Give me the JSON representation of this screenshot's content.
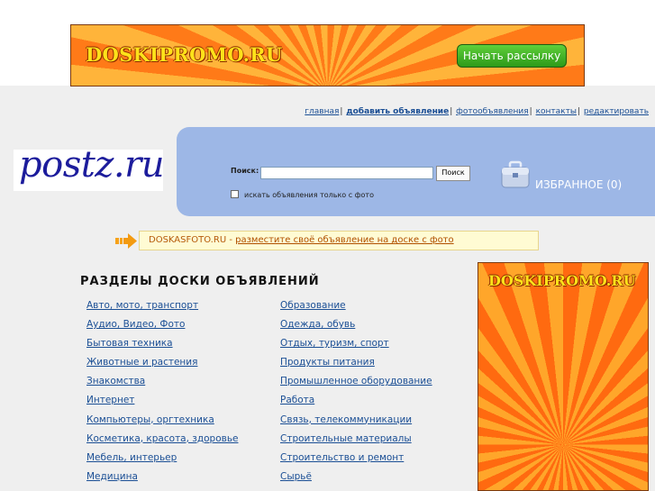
{
  "top_banner": {
    "brand": "DOSKIPROMO.RU",
    "button_label": "Начать рассылку"
  },
  "topnav": {
    "links": [
      {
        "label": "главная"
      },
      {
        "label": "добавить объявление"
      },
      {
        "label": "фотообъявления"
      },
      {
        "label": "контакты"
      },
      {
        "label": "редактировать"
      }
    ],
    "separator": "|"
  },
  "logo": {
    "text": "postz.ru"
  },
  "search": {
    "label": "Поиск:",
    "value": "",
    "button_label": "Поиск",
    "photo_only_label": "искать объявления только с фото",
    "photo_only_checked": false
  },
  "favorites": {
    "label": "ИЗБРАННОЕ (0)",
    "icon": "briefcase-icon"
  },
  "promo": {
    "site": "DOSKASFOTO.RU",
    "separator": " - ",
    "link_text": "разместите своё объявление на доске с фото",
    "icon": "arrow-right-icon"
  },
  "sections": {
    "title": "РАЗДЕЛЫ ДОСКИ ОБЪЯВЛЕНИЙ",
    "left": [
      "Авто, мото, транспорт",
      "Аудио, Видео, Фото",
      "Бытовая техника",
      "Животные и растения",
      "Знакомства",
      "Интернет",
      "Компьютеры, оргтехника",
      "Косметика, красота, здоровье",
      "Мебель, интерьер",
      "Медицина"
    ],
    "right": [
      "Образование",
      "Одежда, обувь",
      "Отдых, туризм, спорт",
      "Продукты питания",
      "Промышленное оборудование",
      "Работа",
      "Связь, телекоммуникации",
      "Строительные материалы",
      "Строительство и ремонт",
      "Сырьё"
    ]
  },
  "side_banner": {
    "brand": "DOSKIPROMO.RU"
  },
  "colors": {
    "link": "#1b4f95",
    "search_panel": "#9db7e6",
    "promo_bg": "#fffbd3",
    "banner_orange": "#ff7a18"
  }
}
